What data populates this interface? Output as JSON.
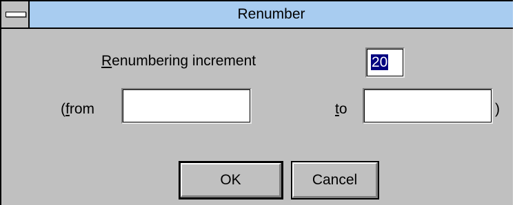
{
  "window": {
    "title": "Renumber"
  },
  "form": {
    "increment_label_mnemonic": "R",
    "increment_label_rest": "enumbering increment",
    "increment_value": "20",
    "from_label_open": "(",
    "from_label_mnemonic": "f",
    "from_label_rest": "rom",
    "from_value": "",
    "to_label_mnemonic": "t",
    "to_label_rest": "o",
    "to_value": "",
    "close_paren": ")"
  },
  "buttons": {
    "ok_label": "OK",
    "cancel_label": "Cancel"
  },
  "colors": {
    "titlebar": "#a8ccf0",
    "dialog_bg": "#c0c0c0",
    "selection": "#000080"
  }
}
